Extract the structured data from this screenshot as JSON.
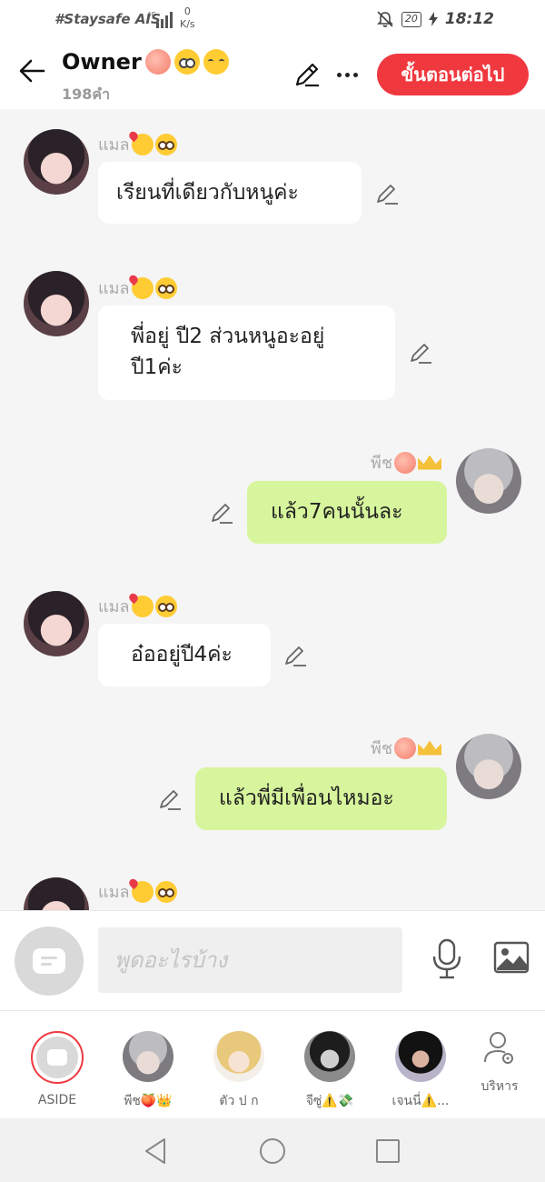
{
  "status": {
    "carrier": "#Staysafe AIS",
    "network": "4G",
    "speed_value": "0",
    "speed_unit": "K/s",
    "battery": "20",
    "time": "18:12"
  },
  "header": {
    "title": "Owner",
    "title_icons": [
      "peach-icon",
      "flushed-face-icon",
      "kissing-face-icon"
    ],
    "word_count": "198คำ",
    "next_button": "ขั้นตอนต่อไป"
  },
  "messages": [
    {
      "side": "left",
      "sender": "แมล",
      "sender_icons": [
        "smiling-hearts-icon",
        "pleading-face-icon"
      ],
      "text": "เรียนที่เดียวกับหนูค่ะ"
    },
    {
      "side": "left",
      "sender": "แมล",
      "sender_icons": [
        "smiling-hearts-icon",
        "pleading-face-icon"
      ],
      "text": "พี่อยู่ ปี2 ส่วนหนูอะอยู่\nปี1ค่ะ"
    },
    {
      "side": "right",
      "sender": "พีช",
      "sender_icons": [
        "peach-icon",
        "crown-icon"
      ],
      "text": "แล้ว7คนนั้นละ"
    },
    {
      "side": "left",
      "sender": "แมล",
      "sender_icons": [
        "smiling-hearts-icon",
        "pleading-face-icon"
      ],
      "text": "อ๋ออยู่ปี4ค่ะ"
    },
    {
      "side": "right",
      "sender": "พีช",
      "sender_icons": [
        "peach-icon",
        "crown-icon"
      ],
      "text": "แล้วพี่มีเพื่อนไหมอะ"
    },
    {
      "side": "left",
      "sender": "แมล",
      "sender_icons": [
        "smiling-hearts-icon",
        "pleading-face-icon"
      ],
      "text": ""
    }
  ],
  "composer": {
    "placeholder": "พูดอะไรบ้าง"
  },
  "characters": [
    {
      "label": "ASIDE"
    },
    {
      "label": "พีช🍑👑"
    },
    {
      "label": "ตัว ป ก"
    },
    {
      "label": "จีซู่⚠️💸"
    },
    {
      "label": "เจนนี่⚠️..."
    }
  ],
  "manage_label": "บริหาร",
  "colors": {
    "accent": "#f0383f",
    "outgoing_bubble": "#d7f59c",
    "incoming_bubble": "#ffffff",
    "chat_background": "#f5f5f5"
  }
}
